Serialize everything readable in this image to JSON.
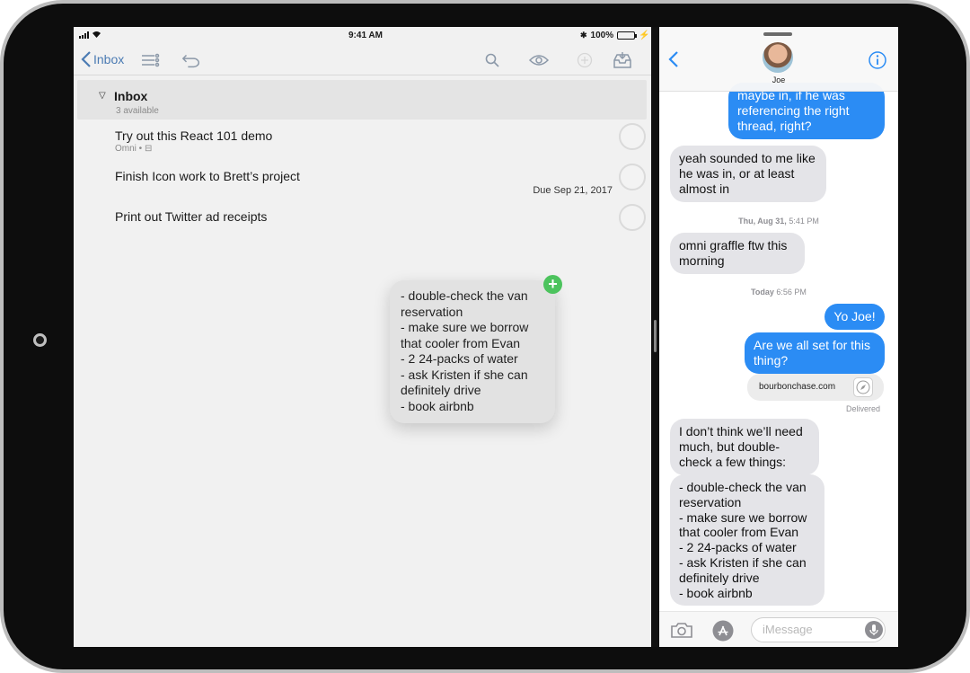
{
  "status": {
    "time": "9:41 AM",
    "battery": "100%",
    "battery_level": 1.0
  },
  "toolbar": {
    "back_label": "Inbox",
    "icons": [
      "list-filter-icon",
      "undo-icon",
      "search-icon",
      "eye-icon",
      "add-circle-icon",
      "inbox-tray-icon"
    ]
  },
  "inbox": {
    "title": "Inbox",
    "subtitle": "3 available",
    "tasks": [
      {
        "title": "Try out this React 101 demo",
        "meta": "Omni • ⊟",
        "due": ""
      },
      {
        "title": "Finish Icon work to Brett’s project",
        "meta": "",
        "due": "Due Sep 21, 2017"
      },
      {
        "title": "Print out Twitter ad receipts",
        "meta": "",
        "due": ""
      }
    ]
  },
  "drag": {
    "lines": [
      "- double-check the van",
      "reservation",
      "- make sure we borrow",
      "that cooler from Evan",
      "- 2 24-packs of water",
      "- ask Kristen if she can",
      "definitely drive",
      "- book airbnb"
    ],
    "badge": "+"
  },
  "messages": {
    "contact": "Joe",
    "b1": "maybe in, if he was referencing the right thread, right?",
    "b2": "yeah sounded to me like he was in, or at least almost in",
    "ts1_day": "Thu, Aug 31,",
    "ts1_time": "5:41 PM",
    "b3": "omni graffle ftw this morning",
    "ts2_day": "Today",
    "ts2_time": "6:56 PM",
    "b4": "Yo Joe!",
    "b5": "Are we all set for this thing?",
    "link": "bourbonchase.com",
    "delivered": "Delivered",
    "b6": "I don’t think we’ll need much, but double-check a few things:",
    "b7_lines": [
      "- double-check the van",
      "reservation",
      "- make sure we borrow",
      "that cooler from Evan",
      "- 2 24-packs of water",
      "- ask Kristen if she can",
      "definitely drive",
      "- book airbnb"
    ],
    "input_placeholder": "iMessage"
  },
  "colors": {
    "accent": "#4b7bb3",
    "outgoing": "#2b8cf4",
    "incoming": "#e4e4e8",
    "badge_green": "#4cc35d"
  }
}
